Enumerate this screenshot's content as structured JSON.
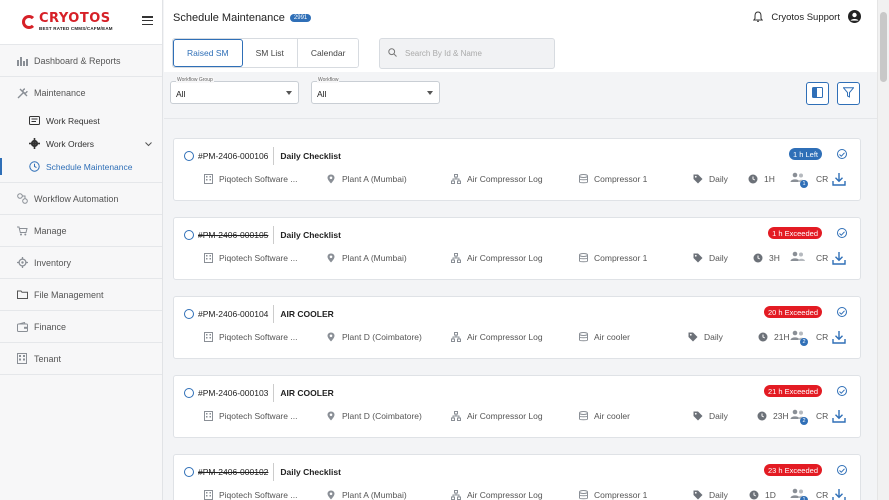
{
  "brand": {
    "name": "CRYOTOS",
    "tagline": "BEST RATED CMMS/CAFM/EAM"
  },
  "sidebar": {
    "items": [
      {
        "label": "Dashboard & Reports"
      },
      {
        "label": "Maintenance"
      },
      {
        "label": "Workflow Automation"
      },
      {
        "label": "Manage"
      },
      {
        "label": "Inventory"
      },
      {
        "label": "File Management"
      },
      {
        "label": "Finance"
      },
      {
        "label": "Tenant"
      }
    ],
    "maintenance_sub": [
      {
        "label": "Work Request"
      },
      {
        "label": "Work Orders"
      },
      {
        "label": "Schedule Maintenance"
      }
    ]
  },
  "header": {
    "title": "Schedule Maintenance",
    "count": "2991",
    "user": "Cryotos Support"
  },
  "tabs": [
    {
      "label": "Raised SM"
    },
    {
      "label": "SM List"
    },
    {
      "label": "Calendar"
    }
  ],
  "search": {
    "placeholder": "Search By Id & Name"
  },
  "filters": {
    "workflow_group": {
      "label": "Workflow Group",
      "value": "All"
    },
    "workflow": {
      "label": "Workflow",
      "value": "All"
    }
  },
  "cards": [
    {
      "id": "#PM-2406-000106",
      "name": "Daily Checklist",
      "status": "1 h Left",
      "status_color": "#2f6fb7",
      "company": "Piqotech Software ...",
      "plant": "Plant A (Mumbai)",
      "asset": "Air Compressor Log",
      "equipment": "Compressor 1",
      "frequency": "Daily",
      "duration": "1H",
      "assignee_count": "1",
      "created_by": "CR",
      "struck": false
    },
    {
      "id": "#PM-2406-000105",
      "name": "Daily Checklist",
      "status": "1 h Exceeded",
      "status_color": "#e31b23",
      "company": "Piqotech Software ...",
      "plant": "Plant A (Mumbai)",
      "asset": "Air Compressor Log",
      "equipment": "Compressor 1",
      "frequency": "Daily",
      "duration": "3H",
      "assignee_count": "",
      "created_by": "CR",
      "struck": true
    },
    {
      "id": "#PM-2406-000104",
      "name": "AIR COOLER",
      "status": "20 h Exceeded",
      "status_color": "#e31b23",
      "company": "Piqotech Software ...",
      "plant": "Plant D (Coimbatore)",
      "asset": "Air Compressor Log",
      "equipment": "Air cooler",
      "frequency": "Daily",
      "duration": "21H",
      "assignee_count": "2",
      "created_by": "CR",
      "struck": false
    },
    {
      "id": "#PM-2406-000103",
      "name": "AIR COOLER",
      "status": "21 h Exceeded",
      "status_color": "#e31b23",
      "company": "Piqotech Software ...",
      "plant": "Plant D (Coimbatore)",
      "asset": "Air Compressor Log",
      "equipment": "Air cooler",
      "frequency": "Daily",
      "duration": "23H",
      "assignee_count": "2",
      "created_by": "CR",
      "struck": false
    },
    {
      "id": "#PM-2406-000102",
      "name": "Daily Checklist",
      "status": "23 h Exceeded",
      "status_color": "#e31b23",
      "company": "Piqotech Software ...",
      "plant": "Plant A (Mumbai)",
      "asset": "Air Compressor Log",
      "equipment": "Compressor 1",
      "frequency": "Daily",
      "duration": "1D",
      "assignee_count": "1",
      "created_by": "CR",
      "struck": true
    }
  ]
}
